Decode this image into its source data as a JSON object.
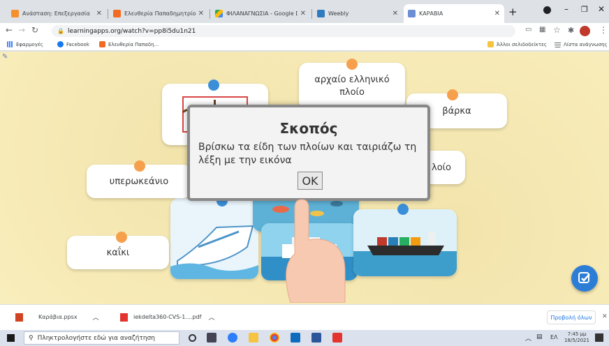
{
  "browser": {
    "tabs": [
      {
        "title": "Ανάσταση: Επεξεργασία",
        "favicon_color": "#f5902d"
      },
      {
        "title": "Ελευθερία Παπαδημητρίου",
        "favicon_color": "#f26b22"
      },
      {
        "title": "ΦΙΛΑΝΑΓΝΩΣΙΑ - Google Dr",
        "favicon_color": "#34a853"
      },
      {
        "title": "Weebly",
        "favicon_color": "#2f7bbf"
      },
      {
        "title": "ΚΑΡΑΒΙΑ",
        "favicon_color": "#6b8fd4",
        "active": true
      }
    ],
    "url": "learningapps.org/watch?v=pp8i5du1n21",
    "bookmarks": [
      {
        "label": "Εφαρμογές",
        "icon": "apps-grid-icon",
        "color": "#4285f4"
      },
      {
        "label": "Facebook",
        "icon": "facebook-icon",
        "color": "#1877f2"
      },
      {
        "label": "Ελευθερία Παπαδη...",
        "icon": "bookmark-icon",
        "color": "#f26b22"
      }
    ],
    "bookmarks_right": [
      {
        "label": "Άλλοι σελιδοδείκτες",
        "icon": "folder-icon",
        "color": "#f6c443"
      },
      {
        "label": "Λίστα ανάγνωσης",
        "icon": "reading-list-icon",
        "color": "#5f6368"
      }
    ]
  },
  "app": {
    "cards": [
      {
        "label": "αρχαίο ελληνικό πλοίο",
        "dot": "orange"
      },
      {
        "label": "βάρκα",
        "dot": "orange"
      },
      {
        "label": "υπερωκεάνιο",
        "dot": "orange"
      },
      {
        "label": "καΐκι",
        "dot": "orange"
      },
      {
        "label": "λοίο",
        "dot": "none"
      }
    ],
    "image_cards": [
      "trireme-image",
      "cruise-ship-image",
      "fishing-boat-image",
      "ferry-image",
      "cargo-ship-image"
    ],
    "modal": {
      "title": "Σκοπός",
      "text": "Βρίσκω τα είδη των πλοίων και ταιριάζω τη λέξη με την εικόνα",
      "ok_label": "OK"
    },
    "accent_blue": "#2b7dd6",
    "accent_orange": "#f6a04d"
  },
  "downloads": {
    "items": [
      {
        "name": "Καράβια.ppsx",
        "icon": "pptx-file-icon"
      },
      {
        "name": "iekdelta360-CVS-1....pdf",
        "icon": "pdf-file-icon"
      }
    ],
    "show_all_label": "Προβολή όλων"
  },
  "taskbar": {
    "search_placeholder": "Πληκτρολογήστε εδώ για αναζήτηση",
    "lang": "ΕΛ",
    "time": "7:45 μμ",
    "date": "18/5/2021"
  }
}
